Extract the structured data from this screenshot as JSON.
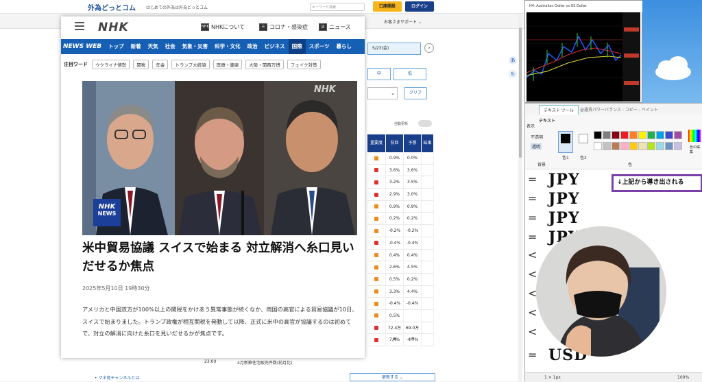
{
  "browser": {
    "site_logo": "外為どっとコム",
    "site_tagline": "はじめての外為は外為どっとコム",
    "search_placeholder": "キーワード検索",
    "account_button": "口座開設",
    "login_button": "ログイン",
    "support_link": "お客さまサポート ⌄",
    "date_picker": "5/23(金)",
    "next_arrow": "›",
    "filter_mid": "中",
    "filter_low": "低",
    "select_arrow": "⌄",
    "clear_button": "クリア",
    "auto_update": "自動更新",
    "table": {
      "headers": [
        "重要度",
        "前回",
        "予想",
        "結果"
      ],
      "rows": [
        {
          "imp": "orange",
          "prev": "0.9%",
          "fcst": "0.0%"
        },
        {
          "imp": "red",
          "prev": "3.6%",
          "fcst": "3.6%"
        },
        {
          "imp": "red",
          "prev": "3.2%",
          "fcst": "3.5%"
        },
        {
          "imp": "red",
          "prev": "2.9%",
          "fcst": "3.0%"
        },
        {
          "imp": "orange",
          "prev": "0.9%",
          "fcst": "0.9%"
        },
        {
          "imp": "orange",
          "prev": "0.2%",
          "fcst": "0.2%"
        },
        {
          "imp": "orange",
          "prev": "-0.2%",
          "fcst": "-0.2%"
        },
        {
          "imp": "red",
          "prev": "-0.4%",
          "fcst": "-0.4%"
        },
        {
          "imp": "orange",
          "prev": "0.4%",
          "fcst": "0.4%"
        },
        {
          "imp": "orange",
          "prev": "2.6%",
          "fcst": "4.5%"
        },
        {
          "imp": "orange",
          "prev": "0.5%",
          "fcst": "0.2%"
        },
        {
          "imp": "orange",
          "prev": "3.3%",
          "fcst": "4.4%"
        },
        {
          "imp": "orange",
          "prev": "-0.4%",
          "fcst": "-0.4%"
        },
        {
          "imp": "orange",
          "prev": "0.5%",
          "fcst": ""
        },
        {
          "imp": "red",
          "prev": "72.4万件",
          "fcst": "69.0万件"
        },
        {
          "imp": "red",
          "prev": "7.4%",
          "fcst": "-4.7%"
        }
      ]
    },
    "bottom_time": "23:00",
    "bottom_event": "4月新築住宅販売件数(前月比)",
    "mane_channel": "• マネ育チャンネルとは",
    "more_button": "更新する ⌄"
  },
  "nhk": {
    "logo": "NHK",
    "header_links": [
      {
        "icon": "NHK",
        "label": "NHKについて"
      },
      {
        "icon": "☰",
        "label": "コロナ・感染症"
      },
      {
        "icon": "▤",
        "label": "ニュース"
      }
    ],
    "nav_brand": "NEWS WEB",
    "nav_items": [
      "トップ",
      "新着",
      "天気",
      "社会",
      "気象・災害",
      "科学・文化",
      "政治",
      "ビジネス",
      "国際",
      "スポーツ",
      "暮らし"
    ],
    "hot_label": "注目ワード",
    "hot_words": [
      "ウクライナ情勢",
      "関税",
      "年金",
      "トランプ大統領",
      "医療・健康",
      "大阪・関西万博",
      "フェイク対策"
    ],
    "watermark": "NHK",
    "badge_line1": "NHK",
    "badge_line2": "NEWS",
    "headline": "米中貿易協議 スイスで始まる 対立解消へ糸口見いだせるか焦点",
    "date": "2025年5月10日 19時30分",
    "body": "アメリカと中国双方が100%以上の関税をかけあう異常事態が続くなか、両国の高官による貿易協議が10日、スイスで始まりました。トランプ政権が相互関税を発動して以降、正式に米中の高官が協議するのは初めてで、対立の解消に向けた糸口を見いだせるかが焦点です。"
  },
  "chart_window": {
    "title": "H4: Australian Dollar vs US Dollar"
  },
  "paint": {
    "tool_tab": "テキスト ツール",
    "doc_title": "@通貨パワーバランス - コピー - ペイント",
    "ribbon_tab": "テキスト",
    "view_label": "表示",
    "opaque": "不透明",
    "transparent": "透明",
    "color1": "色1",
    "color2": "色2",
    "bg_label": "背景",
    "color_label": "色",
    "edit_colors": "色の編集",
    "callout": "↓上記から導き出される",
    "currency_lines": [
      "JPY",
      "JPY",
      "JPY",
      "JPY",
      "",
      "",
      "",
      "",
      "",
      "USD"
    ],
    "status_size": "1 × 1px",
    "zoom": "100%"
  },
  "colors": {
    "nhk_blue": "#1560b5",
    "nhk_nav_active": "#0c3f85",
    "callout_border": "#7a3fa8",
    "table_header": "#1a3f8a",
    "account_button": "#f5b51b"
  }
}
